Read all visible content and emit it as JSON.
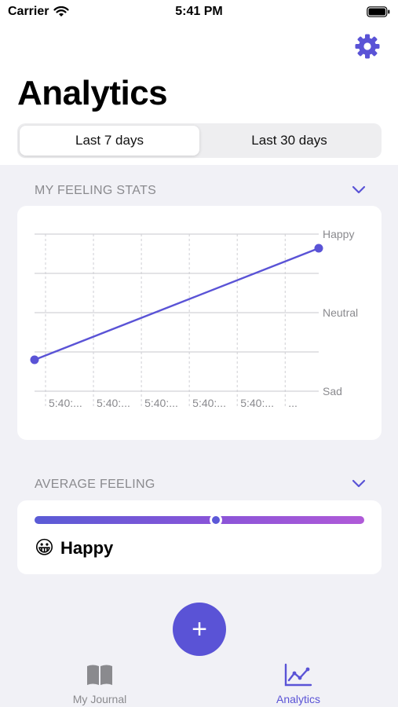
{
  "status_bar": {
    "carrier": "Carrier",
    "time": "5:41 PM"
  },
  "header": {
    "title": "Analytics",
    "settings_icon": "gear-icon",
    "tabs": [
      {
        "label": "Last 7 days",
        "selected": true
      },
      {
        "label": "Last 30 days",
        "selected": false
      }
    ]
  },
  "feeling_stats": {
    "section_title": "MY FEELING STATS",
    "y_labels": [
      "Happy",
      "Neutral",
      "Sad"
    ],
    "x_labels": [
      "5:40:...",
      "5:40:...",
      "5:40:...",
      "5:40:...",
      "5:40:...",
      "..."
    ]
  },
  "average_feeling": {
    "section_title": "AVERAGE FEELING",
    "emoji": "😀",
    "label": "Happy",
    "level": 0.55
  },
  "fab": {
    "label": "+"
  },
  "tab_bar": {
    "items": [
      {
        "label": "My Journal",
        "icon": "book-icon",
        "active": false
      },
      {
        "label": "Analytics",
        "icon": "chart-icon",
        "active": true
      }
    ]
  },
  "colors": {
    "accent": "#5a53d6",
    "inactive": "#8a8a8e",
    "background": "#f1f1f6"
  },
  "chart_data": {
    "type": "line",
    "title": "",
    "xlabel": "",
    "ylabel": "",
    "categories_y": [
      "Sad",
      "Neutral",
      "Happy"
    ],
    "x": [
      "5:40:...",
      "5:40:...",
      "5:40:...",
      "5:40:...",
      "5:40:...",
      "..."
    ],
    "series": [
      {
        "points": [
          {
            "x_index": 0,
            "y": 0.4
          },
          {
            "x_index": 5.5,
            "y": 1.82
          }
        ]
      }
    ],
    "ylim": [
      0,
      2
    ],
    "grid": true,
    "legend": "none"
  }
}
